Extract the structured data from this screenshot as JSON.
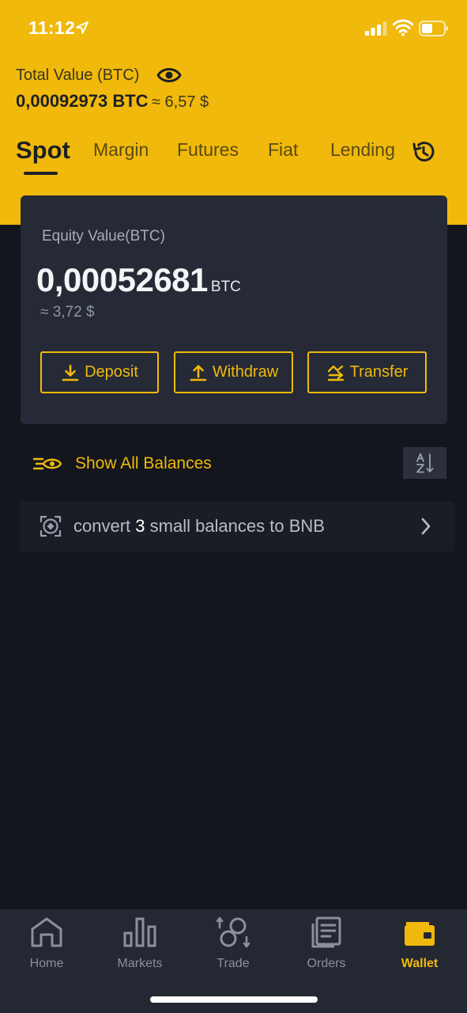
{
  "status_bar": {
    "time": "11:12"
  },
  "colors": {
    "brand": "#f0b90b",
    "background": "#14161d",
    "card": "#252a36"
  },
  "header": {
    "total_label": "Total Value (BTC)",
    "total_btc": "0,00092973 BTC",
    "total_approx": "≈ 6,57 $"
  },
  "tabs": [
    {
      "label": "Spot",
      "active": true
    },
    {
      "label": "Margin"
    },
    {
      "label": "Futures"
    },
    {
      "label": "Fiat"
    },
    {
      "label": "Lending"
    }
  ],
  "card": {
    "equity_label": "Equity Value(BTC)",
    "equity_value": "0,00052681",
    "equity_unit": "BTC",
    "equity_approx": "≈ 3,72 $",
    "deposit_label": "Deposit",
    "withdraw_label": "Withdraw",
    "transfer_label": "Transfer"
  },
  "balances": {
    "show_all_label": "Show All Balances",
    "convert_prefix": "convert ",
    "convert_count": "3",
    "convert_suffix": " small balances to BNB"
  },
  "nav": [
    {
      "label": "Home",
      "icon": "home-icon"
    },
    {
      "label": "Markets",
      "icon": "markets-icon"
    },
    {
      "label": "Trade",
      "icon": "trade-icon"
    },
    {
      "label": "Orders",
      "icon": "orders-icon"
    },
    {
      "label": "Wallet",
      "icon": "wallet-icon",
      "active": true
    }
  ]
}
